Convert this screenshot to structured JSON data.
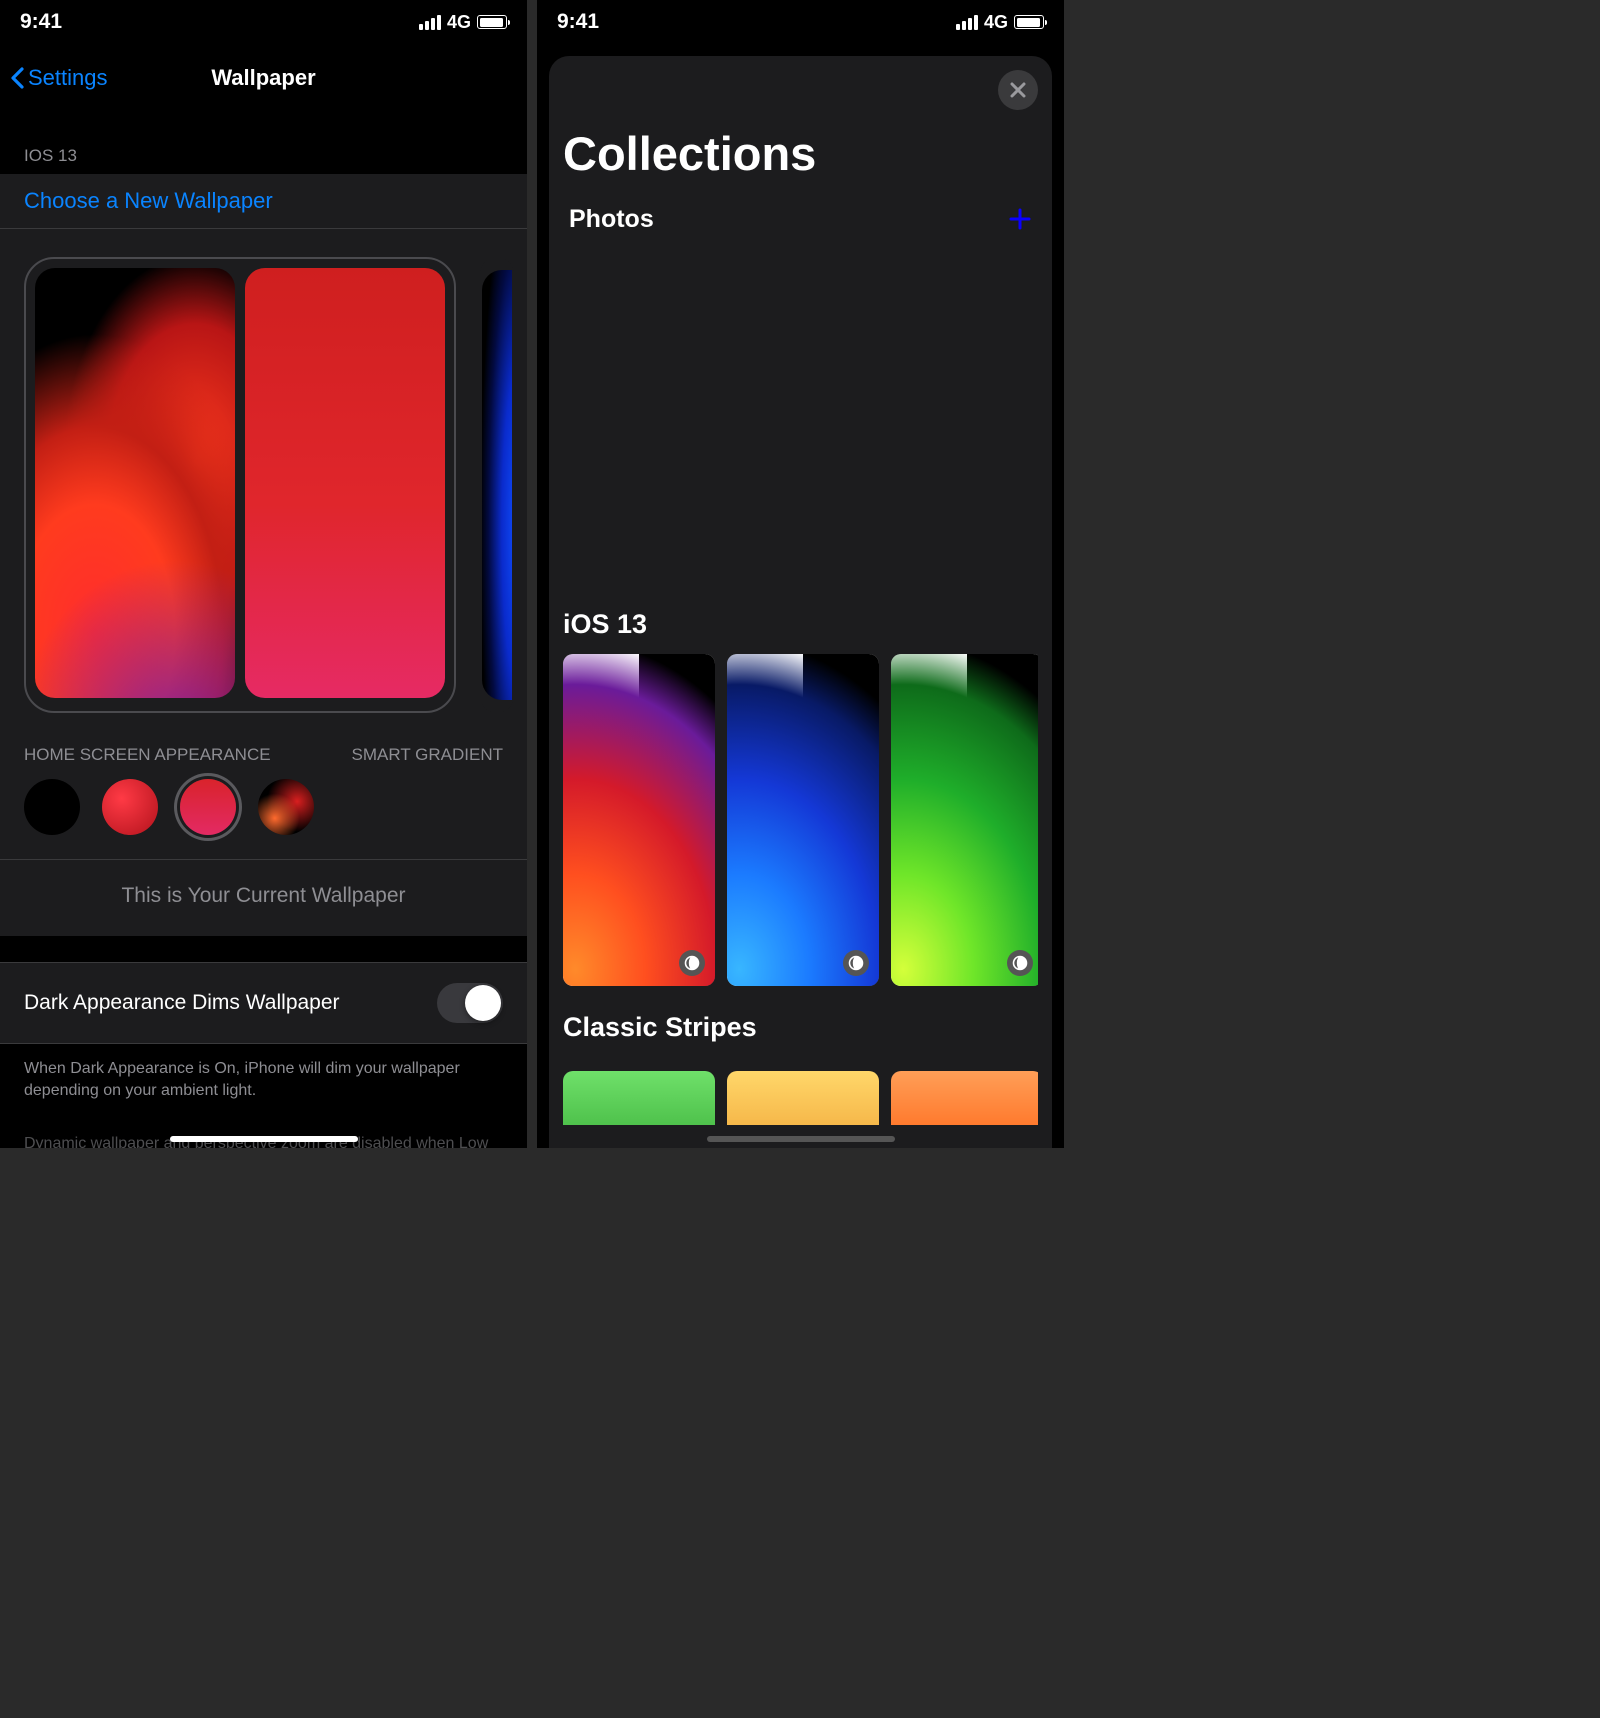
{
  "statusbar": {
    "time": "9:41",
    "network": "4G"
  },
  "left": {
    "nav": {
      "back": "Settings",
      "title": "Wallpaper"
    },
    "section_header": "IOS 13",
    "choose_link": "Choose a New Wallpaper",
    "hsa_label": "HOME SCREEN APPEARANCE",
    "smart_gradient": "SMART GRADIENT",
    "current_note": "This is Your Current Wallpaper",
    "toggle_label": "Dark Appearance Dims Wallpaper",
    "toggle_value": true,
    "footer1": "When Dark Appearance is On, iPhone will dim your wallpaper depending on your ambient light.",
    "footer2": "Dynamic wallpaper and perspective zoom are disabled when Low"
  },
  "right": {
    "title": "Collections",
    "photos_label": "Photos",
    "ios13_label": "iOS 13",
    "classic_label": "Classic Stripes"
  }
}
